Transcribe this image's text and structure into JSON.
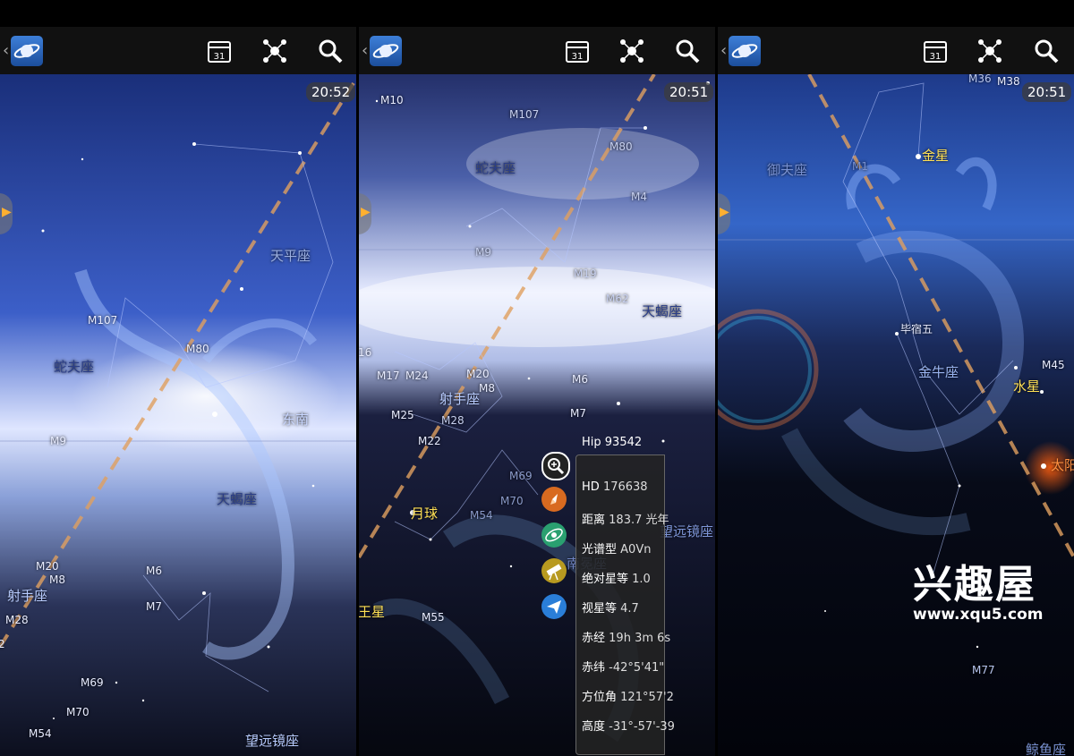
{
  "panels": [
    {
      "time": "20:52",
      "labels": {
        "m107": "M107",
        "ophiuchus": "蛇夫座",
        "libra": "天平座",
        "m80": "M80",
        "dongnan": "东南",
        "m9": "M9",
        "scorpius": "天蝎座",
        "m20": "M20",
        "m8": "M8",
        "sagittarius": "射手座",
        "m6": "M6",
        "m7": "M7",
        "m28": "M28",
        "m69": "M69",
        "m70": "M70",
        "m54": "M54",
        "telescopium": "望远镜座",
        "edge2": "2"
      }
    },
    {
      "time": "20:51",
      "labels": {
        "m10": "M10",
        "m107": "M107",
        "ophiuchus": "蛇夫座",
        "m80": "M80",
        "m4": "M4",
        "m9": "M9",
        "m19": "M19",
        "m62": "M62",
        "scorpius": "天蝎座",
        "n16": "16",
        "m17": "M17",
        "m24": "M24",
        "m20": "M20",
        "m8": "M8",
        "sagittarius": "射手座",
        "m6": "M6",
        "m25": "M25",
        "m28": "M28",
        "m7": "M7",
        "m22": "M22",
        "m69": "M69",
        "moon": "月球",
        "m54": "M54",
        "m70": "M70",
        "telescopium": "望远镜座",
        "corona_australis": "南冕座",
        "wangxing": "王星",
        "m55": "M55"
      },
      "info_panel": {
        "hip_name": "Hip",
        "hip_value": "93542",
        "rows": [
          {
            "label": "HD",
            "value": "176638"
          },
          {
            "label": "距离",
            "value": "183.7 光年"
          },
          {
            "label": "光谱型",
            "value": "A0Vn"
          },
          {
            "label": "绝对星等",
            "value": "1.0"
          },
          {
            "label": "视星等",
            "value": "4.7"
          },
          {
            "label": "赤经",
            "value": "19h 3m 6s"
          },
          {
            "label": "赤纬",
            "value": "-42°5'41\""
          },
          {
            "label": "方位角",
            "value": "121°57'2"
          },
          {
            "label": "高度",
            "value": "-31°-57'-39"
          }
        ]
      }
    },
    {
      "time": "20:51",
      "labels": {
        "m36": "M36",
        "m38": "M38",
        "venus": "金星",
        "auriga": "御夫座",
        "m1": "M1",
        "aldebaran": "毕宿五",
        "taurus": "金牛座",
        "m45": "M45",
        "mercury": "水星",
        "sun": "太阳",
        "m77": "M77",
        "cetus": "鲸鱼座"
      }
    }
  ],
  "watermark": {
    "title": "兴趣屋",
    "url": "www.xqu5.com"
  },
  "icons": {
    "logo": "saturn-logo-icon",
    "calendar": "calendar-icon",
    "constellation": "constellation-icon",
    "search": "search-icon",
    "side_arrow": "chevron-right-icon"
  },
  "colors": {
    "ecliptic": "#e0a060",
    "toolbar": "#111111",
    "planet_label": "#ffe055",
    "accent": "#ffb030"
  }
}
